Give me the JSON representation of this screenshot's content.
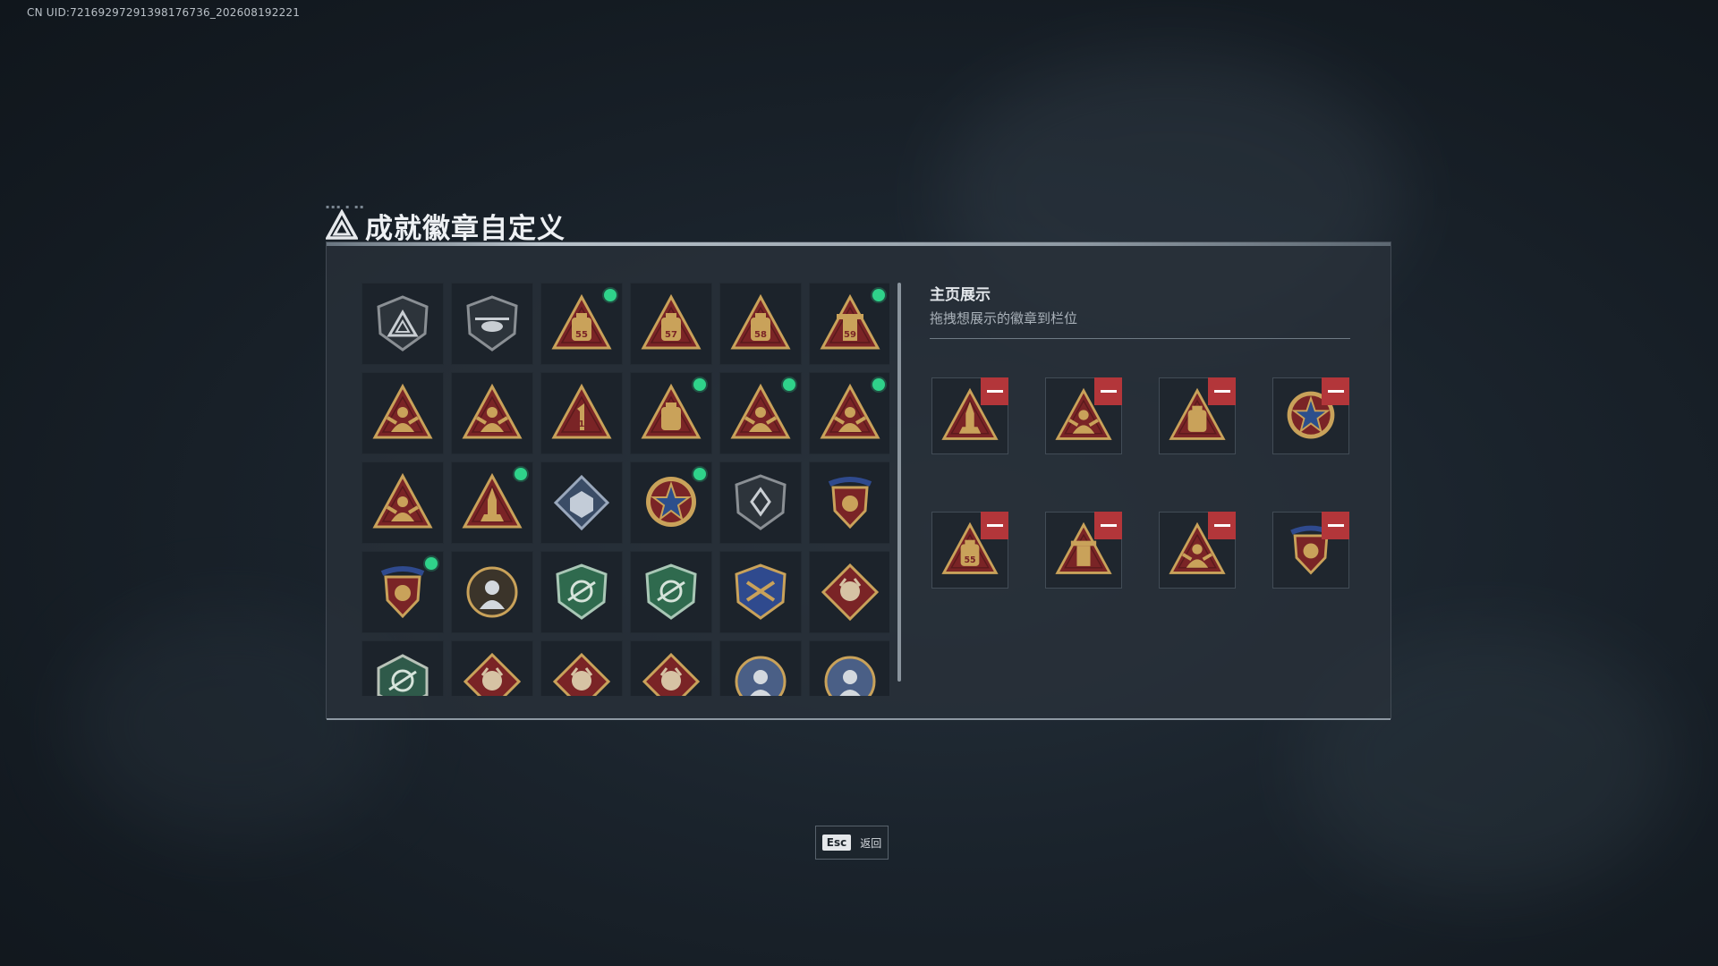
{
  "uid_text": "CN UID:72169297291398176736_202608192221",
  "header": {
    "title": "成就徽章自定义"
  },
  "showcase": {
    "title": "主页展示",
    "subtitle": "拖拽想展示的徽章到栏位",
    "slots": [
      {
        "icon": "rocket-triangle-badge"
      },
      {
        "icon": "hands-triangle-badge"
      },
      {
        "icon": "cannister-triangle-badge"
      },
      {
        "icon": "red-star-medal-badge"
      },
      {
        "icon": "bag-55-triangle-badge"
      },
      {
        "icon": "tower-triangle-badge"
      },
      {
        "icon": "kneeling-soldier-triangle-badge"
      },
      {
        "icon": "crest-shield-badge"
      }
    ]
  },
  "badges": [
    {
      "icon": "dark-triangle-shield-badge",
      "new": false
    },
    {
      "icon": "helicopter-shield-badge",
      "new": false
    },
    {
      "icon": "bag-55-triangle-badge",
      "new": true
    },
    {
      "icon": "bag-57-triangle-badge",
      "new": false
    },
    {
      "icon": "bag-58-triangle-badge",
      "new": false
    },
    {
      "icon": "tower-59-triangle-badge",
      "new": true
    },
    {
      "icon": "hand-gesture-triangle-badge",
      "new": false
    },
    {
      "icon": "hands-cup-triangle-badge",
      "new": false
    },
    {
      "icon": "number-one-triangle-badge",
      "new": false
    },
    {
      "icon": "cannister-triangle-badge",
      "new": true
    },
    {
      "icon": "kneeling-soldier-triangle-badge",
      "new": true
    },
    {
      "icon": "hands-triangle-badge",
      "new": true
    },
    {
      "icon": "soldier-triangle-badge",
      "new": false
    },
    {
      "icon": "rocket-triangle-badge",
      "new": true
    },
    {
      "icon": "cube-diamond-badge",
      "new": false
    },
    {
      "icon": "red-star-medal-badge",
      "new": true
    },
    {
      "icon": "hand-shield-badge",
      "new": false
    },
    {
      "icon": "crest-shield-badge",
      "new": false
    },
    {
      "icon": "crest-shield-badge",
      "new": true
    },
    {
      "icon": "soldier-round-badge",
      "new": false
    },
    {
      "icon": "green-crosshair-shield-badge",
      "new": false
    },
    {
      "icon": "green-rifle-shield-badge",
      "new": false
    },
    {
      "icon": "blue-gold-shield-badge",
      "new": false
    },
    {
      "icon": "wolf-diamond-badge",
      "new": false
    },
    {
      "icon": "green-dragon-hex-badge",
      "new": false
    },
    {
      "icon": "red-dragon-diamond-badge",
      "new": false
    },
    {
      "icon": "red-dragon-diamond-badge",
      "new": false
    },
    {
      "icon": "red-soldier-diamond-badge",
      "new": false
    },
    {
      "icon": "blue-beast-round-badge",
      "new": false
    },
    {
      "icon": "blue-beast-round-badge",
      "new": false
    }
  ],
  "badge_labels": {
    "bag-55-triangle-badge": "55",
    "bag-57-triangle-badge": "57",
    "bag-58-triangle-badge": "58",
    "tower-59-triangle-badge": "59",
    "number-one-triangle-badge": "1"
  },
  "esc": {
    "key": "Esc",
    "label": "返回"
  },
  "colors": {
    "accent_new": "#2fd28a",
    "remove_red": "#b3363a",
    "badge_gold": "#c9a25a",
    "badge_red": "#7a2426"
  }
}
